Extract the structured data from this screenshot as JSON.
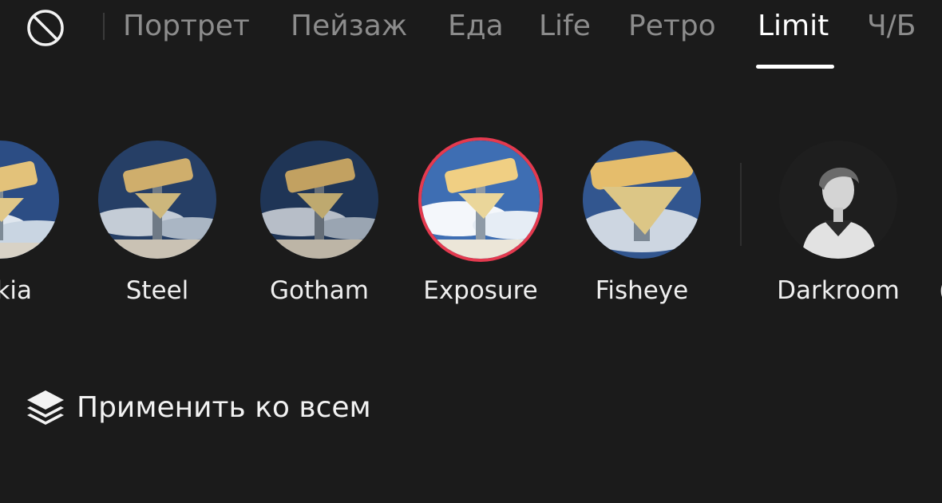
{
  "tabs": {
    "none_icon": "no-filter-icon",
    "items": [
      {
        "label": "Портрет",
        "active": false
      },
      {
        "label": "Пейзаж",
        "active": false
      },
      {
        "label": "Еда",
        "active": false
      },
      {
        "label": "Life",
        "active": false
      },
      {
        "label": "Ретро",
        "active": false
      },
      {
        "label": "Limit",
        "active": true
      },
      {
        "label": "Ч/Б",
        "active": false
      }
    ]
  },
  "filters": {
    "items": [
      {
        "label": "kia",
        "thumbnail": "retro-sign-photo",
        "selected": false
      },
      {
        "label": "Steel",
        "thumbnail": "retro-sign-photo",
        "selected": false
      },
      {
        "label": "Gotham",
        "thumbnail": "retro-sign-photo",
        "selected": false
      },
      {
        "label": "Exposure",
        "thumbnail": "retro-sign-photo",
        "selected": true
      },
      {
        "label": "Fisheye",
        "thumbnail": "retro-sign-photo-fisheye",
        "selected": false
      },
      {
        "label": "Darkroom",
        "thumbnail": "bw-portrait-photo",
        "selected": false
      }
    ],
    "selected_color": "#e43a4f"
  },
  "apply_all": {
    "icon": "layers-icon",
    "label": "Применить ко всем"
  }
}
